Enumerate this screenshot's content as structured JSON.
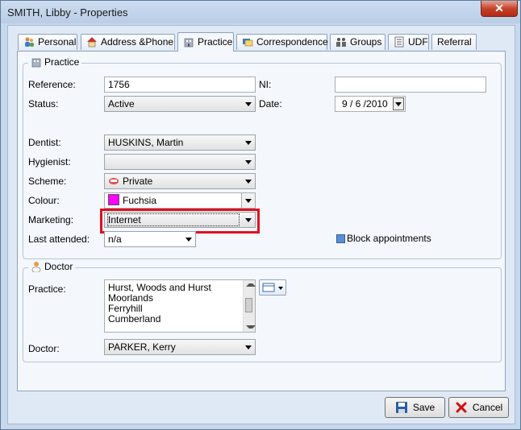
{
  "window": {
    "title": "SMITH, Libby - Properties",
    "close_glyph": "✕"
  },
  "tabs": [
    {
      "label": "Personal",
      "icon": "people-icon"
    },
    {
      "label": "Address &Phone",
      "icon": "house-icon"
    },
    {
      "label": "Practice",
      "icon": "building-icon"
    },
    {
      "label": "Correspondence",
      "icon": "letters-icon"
    },
    {
      "label": "Groups",
      "icon": "group-icon"
    },
    {
      "label": "UDF",
      "icon": "form-icon"
    },
    {
      "label": "Referral",
      "icon": ""
    }
  ],
  "practice": {
    "group_title": "Practice",
    "reference_label": "Reference:",
    "reference_value": "1756",
    "ni_label": "NI:",
    "ni_value": "",
    "status_label": "Status:",
    "status_value": "Active",
    "date_label": "Date:",
    "date_value": "9 / 6 /2010",
    "dentist_label": "Dentist:",
    "dentist_value": "HUSKINS, Martin",
    "hygienist_label": "Hygienist:",
    "hygienist_value": "",
    "scheme_label": "Scheme:",
    "scheme_value": "Private",
    "colour_label": "Colour:",
    "colour_value": "Fuchsia",
    "colour_swatch": "#ff00ff",
    "marketing_label": "Marketing:",
    "marketing_value": "Internet",
    "last_attended_label": "Last attended:",
    "last_attended_value": "n/a",
    "block_appointments_label": "Block appointments"
  },
  "doctor": {
    "group_title": "Doctor",
    "practice_label": "Practice:",
    "practice_lines": [
      "Hurst, Woods and Hurst",
      "Moorlands",
      "Ferryhill",
      "Cumberland"
    ],
    "doctor_label": "Doctor:",
    "doctor_value": "PARKER, Kerry"
  },
  "buttons": {
    "save": "Save",
    "cancel": "Cancel"
  },
  "colors": {
    "highlight": "#e01020",
    "accent": "#5a8ed0"
  }
}
